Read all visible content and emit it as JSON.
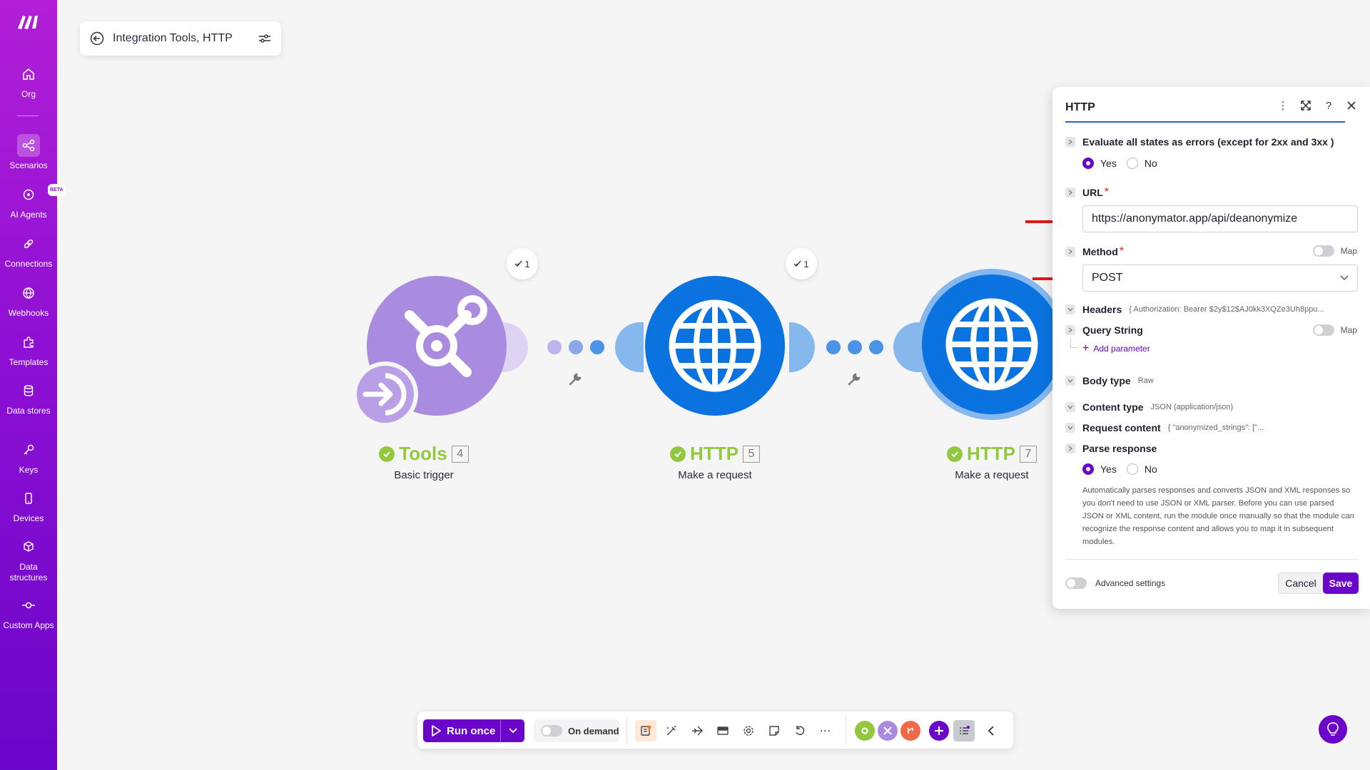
{
  "sidebar": {
    "items": [
      {
        "label": "Org",
        "icon": "home-icon"
      },
      {
        "label": "Scenarios",
        "icon": "share-icon"
      },
      {
        "label": "AI Agents",
        "icon": "ai-agent-icon",
        "badge": "BETA"
      },
      {
        "label": "Connections",
        "icon": "link-icon"
      },
      {
        "label": "Webhooks",
        "icon": "globe-icon"
      },
      {
        "label": "Templates",
        "icon": "puzzle-icon"
      },
      {
        "label": "Data stores",
        "icon": "database-icon"
      },
      {
        "label": "Keys",
        "icon": "key-icon"
      },
      {
        "label": "Devices",
        "icon": "device-icon"
      },
      {
        "label": "Data structures",
        "icon": "cube-icon"
      },
      {
        "label": "Custom Apps",
        "icon": "custom-apps-icon"
      }
    ]
  },
  "scenario": {
    "title": "Integration Tools, HTTP"
  },
  "modules": [
    {
      "name": "Tools",
      "number": "4",
      "subtitle": "Basic trigger",
      "ops": "1"
    },
    {
      "name": "HTTP",
      "number": "5",
      "subtitle": "Make a request",
      "ops": "1"
    },
    {
      "name": "HTTP",
      "number": "7",
      "subtitle": "Make a request"
    }
  ],
  "panel": {
    "title": "HTTP",
    "evaluate_label": "Evaluate all states as errors (except for 2xx and 3xx )",
    "yes": "Yes",
    "no": "No",
    "url_label": "URL",
    "url_value": "https://anonymator.app/api/deanonymize",
    "method_label": "Method",
    "method_value": "POST",
    "map_label": "Map",
    "headers_label": "Headers",
    "headers_hint": "{ Authorization: Bearer $2y$12$AJ0kk3XQZe3Uh8ppu...",
    "query_label": "Query String",
    "add_parameter": "Add parameter",
    "body_type_label": "Body type",
    "body_type_hint": "Raw",
    "content_type_label": "Content type",
    "content_type_hint": "JSON (application/json)",
    "request_content_label": "Request content",
    "request_content_hint": "{ \"anonymized_strings\": [\"...",
    "parse_label": "Parse response",
    "parse_desc": "Automatically parses responses and converts JSON and XML responses so you don't need to use JSON or XML parser. Before you can use parsed JSON or XML content, run the module once manually so that the module can recognize the response content and allows you to map it in subsequent modules.",
    "advanced_label": "Advanced settings",
    "cancel": "Cancel",
    "save": "Save",
    "required_mark": "*"
  },
  "toolbar": {
    "run_once": "Run once",
    "on_demand": "On demand"
  },
  "colors": {
    "brand": "#6a06c9",
    "tools_module": "#a98ce0",
    "http_module": "#0a73e0",
    "success": "#93c83e",
    "arrow": "#e01818"
  }
}
